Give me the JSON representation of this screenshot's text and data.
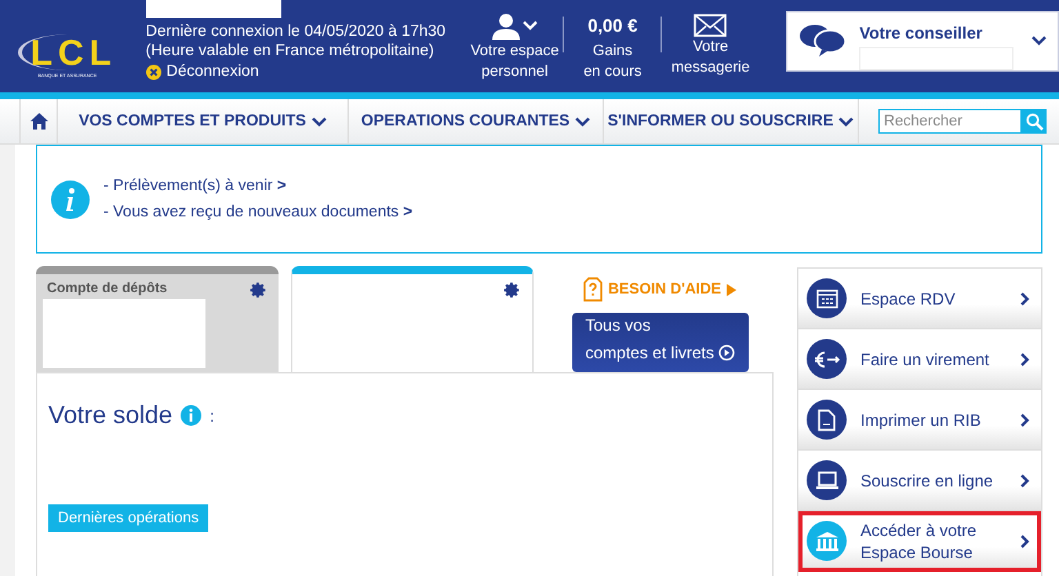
{
  "header": {
    "logo": {
      "name": "LCL",
      "tagline": "BANQUE ET ASSURANCE"
    },
    "last_login": [
      "Dernière connexion le 04/05/2020 à 17h30",
      "(Heure valable en France métropolitaine)"
    ],
    "logout": "Déconnexion",
    "shortcuts": [
      {
        "kind": "person",
        "lines": [
          "Votre espace",
          "personnel"
        ]
      },
      {
        "kind": "amount",
        "amount": "0,00 €",
        "lines": [
          "Gains",
          "en cours"
        ]
      },
      {
        "kind": "mail",
        "lines": [
          "Votre",
          "messagerie"
        ]
      }
    ],
    "advisor": {
      "title": "Votre conseiller"
    }
  },
  "nav": {
    "items": [
      "VOS COMPTES ET PRODUITS",
      "OPERATIONS COURANTES",
      "S'INFORMER OU SOUSCRIRE"
    ],
    "search": {
      "placeholder": "Rechercher"
    }
  },
  "notices": [
    {
      "text": "- Prélèvement(s) à venir",
      "arrow": ">"
    },
    {
      "text": "- Vous avez reçu de nouveaux documents",
      "arrow": ">"
    }
  ],
  "account_tabs": [
    {
      "title": "Compte de dépôts",
      "selected": false
    },
    {
      "selected": true
    }
  ],
  "help": {
    "label": "BESOIN D'AIDE",
    "button": [
      "Tous vos",
      "comptes et livrets"
    ]
  },
  "balance": {
    "title": "Votre solde",
    "suffix": ":",
    "operations_tab": "Dernières opérations"
  },
  "quick_links": [
    {
      "kind": "calendar",
      "lines": [
        "Espace RDV"
      ],
      "highlighted": false
    },
    {
      "kind": "transfer",
      "lines": [
        "Faire un virement"
      ],
      "highlighted": false
    },
    {
      "kind": "document",
      "lines": [
        "Imprimer un RIB"
      ],
      "highlighted": false
    },
    {
      "kind": "laptop",
      "lines": [
        "Souscrire en ligne"
      ],
      "highlighted": false
    },
    {
      "kind": "bank",
      "lines": [
        "Accéder à votre",
        "Espace Bourse"
      ],
      "highlighted": true
    }
  ]
}
